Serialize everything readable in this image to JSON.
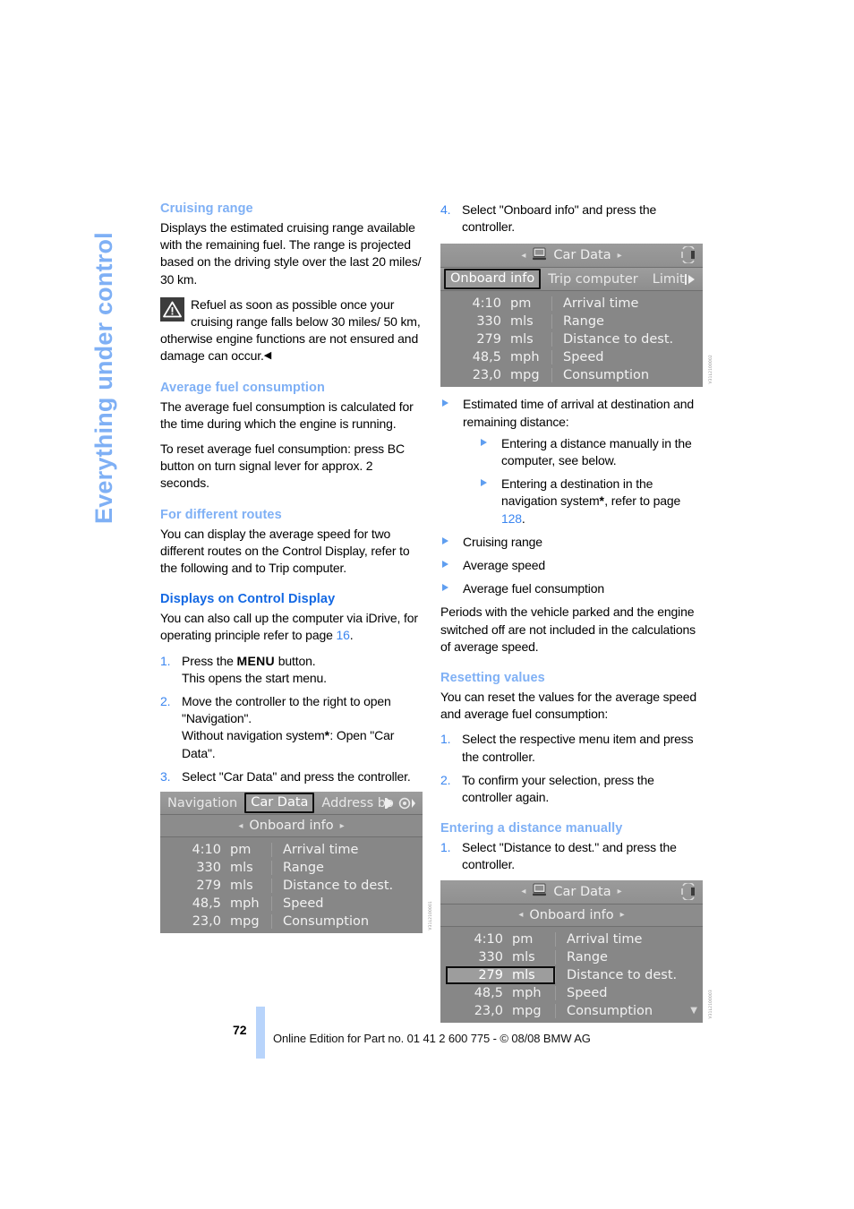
{
  "side_running_head": "Everything under control",
  "page_number": "72",
  "footer": "Online Edition for Part no. 01 41 2 600 775 - © 08/08 BMW AG",
  "left_column": {
    "cruising_range": {
      "heading": "Cruising range",
      "paragraph": "Displays the estimated cruising range available with the remaining fuel. The range is projected based on the driving style over the last 20 miles/ 30 km.",
      "warning": "Refuel as soon as possible once your cruising range falls below 30 miles/ 50 km, otherwise engine functions are not ensured and damage can occur.",
      "warning_endmark": "◀"
    },
    "average_fuel_consumption": {
      "heading": "Average fuel consumption",
      "paragraph1": "The average fuel consumption is calculated for the time during which the engine is running.",
      "paragraph2": "To reset average fuel consumption: press BC button on turn signal lever for approx. 2 seconds."
    },
    "for_different_routes": {
      "heading": "For different routes",
      "paragraph": "You can display the average speed for two different routes on the Control Display, refer to the following and to Trip computer."
    },
    "displays_on_control_display": {
      "heading": "Displays on Control Display",
      "intro_a": "You can also call up the computer via iDrive, for operating principle refer to page ",
      "intro_page_ref": "16",
      "intro_b": ".",
      "steps": [
        {
          "num": "1.",
          "pre": "Press the ",
          "key": "MENU",
          "post": " button.",
          "line2": "This opens the start menu."
        },
        {
          "num": "2.",
          "text": "Move the controller to the right to open \"Navigation\".",
          "line2_a": "Without navigation system",
          "line2_star": "*",
          "line2_b": ": Open \"Car Data\"."
        },
        {
          "num": "3.",
          "text": "Select \"Car Data\" and press the controller."
        }
      ]
    },
    "screen_nav": {
      "caption_id": "V31L2100001",
      "tabs": [
        {
          "label": "Navigation",
          "selected": false
        },
        {
          "label": "Car Data",
          "selected": true
        },
        {
          "label": "Address bo",
          "selected": false
        }
      ],
      "submenu": {
        "label": "Onboard info",
        "left_arrow": "◂",
        "right_arrow": "▸"
      },
      "rows": [
        {
          "value": "4:10",
          "unit": "pm",
          "name": "Arrival time",
          "selected": false
        },
        {
          "value": "330",
          "unit": "mls",
          "name": "Range",
          "selected": false
        },
        {
          "value": "279",
          "unit": "mls",
          "name": "Distance to dest.",
          "selected": false
        },
        {
          "value": "48,5",
          "unit": "mph",
          "name": "Speed",
          "selected": false
        },
        {
          "value": "23,0",
          "unit": "mpg",
          "name": "Consumption",
          "selected": false
        }
      ]
    }
  },
  "right_column": {
    "step4": {
      "num": "4.",
      "text": "Select \"Onboard info\" and press the controller."
    },
    "screen_onboard": {
      "caption_id": "V31L2100002",
      "title": "Car Data",
      "title_left_arrow": "◂",
      "title_right_arrow": "▸",
      "tabs": [
        {
          "label": "Onboard info",
          "selected": true
        },
        {
          "label": "Trip computer",
          "selected": false
        },
        {
          "label": "Limit",
          "selected": false
        }
      ],
      "rows": [
        {
          "value": "4:10",
          "unit": "pm",
          "name": "Arrival time",
          "selected": false
        },
        {
          "value": "330",
          "unit": "mls",
          "name": "Range",
          "selected": false
        },
        {
          "value": "279",
          "unit": "mls",
          "name": "Distance to dest.",
          "selected": false
        },
        {
          "value": "48,5",
          "unit": "mph",
          "name": "Speed",
          "selected": false
        },
        {
          "value": "23,0",
          "unit": "mpg",
          "name": "Consumption",
          "selected": false
        }
      ]
    },
    "bullets": {
      "item1": "Estimated time of arrival at destination and remaining distance:",
      "sub1": "Entering a distance manually in the computer, see below.",
      "sub2_a": "Entering a destination in the navigation system",
      "sub2_star": "*",
      "sub2_b": ", refer to page ",
      "sub2_page_ref": "128",
      "sub2_c": ".",
      "item2": "Cruising range",
      "item3": "Average speed",
      "item4": "Average fuel consumption",
      "closing": "Periods with the vehicle parked and the engine switched off are not included in the calculations of average speed."
    },
    "resetting_values": {
      "heading": "Resetting values",
      "paragraph": "You can reset the values for the average speed and average fuel consumption:",
      "steps": [
        {
          "num": "1.",
          "text": "Select the respective menu item and press the controller."
        },
        {
          "num": "2.",
          "text": "To confirm your selection, press the controller again."
        }
      ]
    },
    "entering_distance": {
      "heading": "Entering a distance manually",
      "steps": [
        {
          "num": "1.",
          "text": "Select \"Distance to dest.\" and press the controller."
        }
      ]
    },
    "screen_distance": {
      "caption_id": "V31L2100003",
      "title": "Car Data",
      "title_left_arrow": "◂",
      "title_right_arrow": "▸",
      "submenu": {
        "label": "Onboard info",
        "left_arrow": "◂",
        "right_arrow": "▸"
      },
      "rows": [
        {
          "value": "4:10",
          "unit": "pm",
          "name": "Arrival time",
          "selected": false
        },
        {
          "value": "330",
          "unit": "mls",
          "name": "Range",
          "selected": false
        },
        {
          "value": "279",
          "unit": "mls",
          "name": "Distance to dest.",
          "selected": true
        },
        {
          "value": "48,5",
          "unit": "mph",
          "name": "Speed",
          "selected": false
        },
        {
          "value": "23,0",
          "unit": "mpg",
          "name": "Consumption",
          "selected": false
        }
      ]
    }
  },
  "colors": {
    "heading_light_blue": "#7fb0f5",
    "heading_strong_blue": "#1368e3",
    "link_blue": "#3b86f0",
    "folio_bar": "#b8d4fb",
    "screen_gray": "#8a8a8a"
  }
}
